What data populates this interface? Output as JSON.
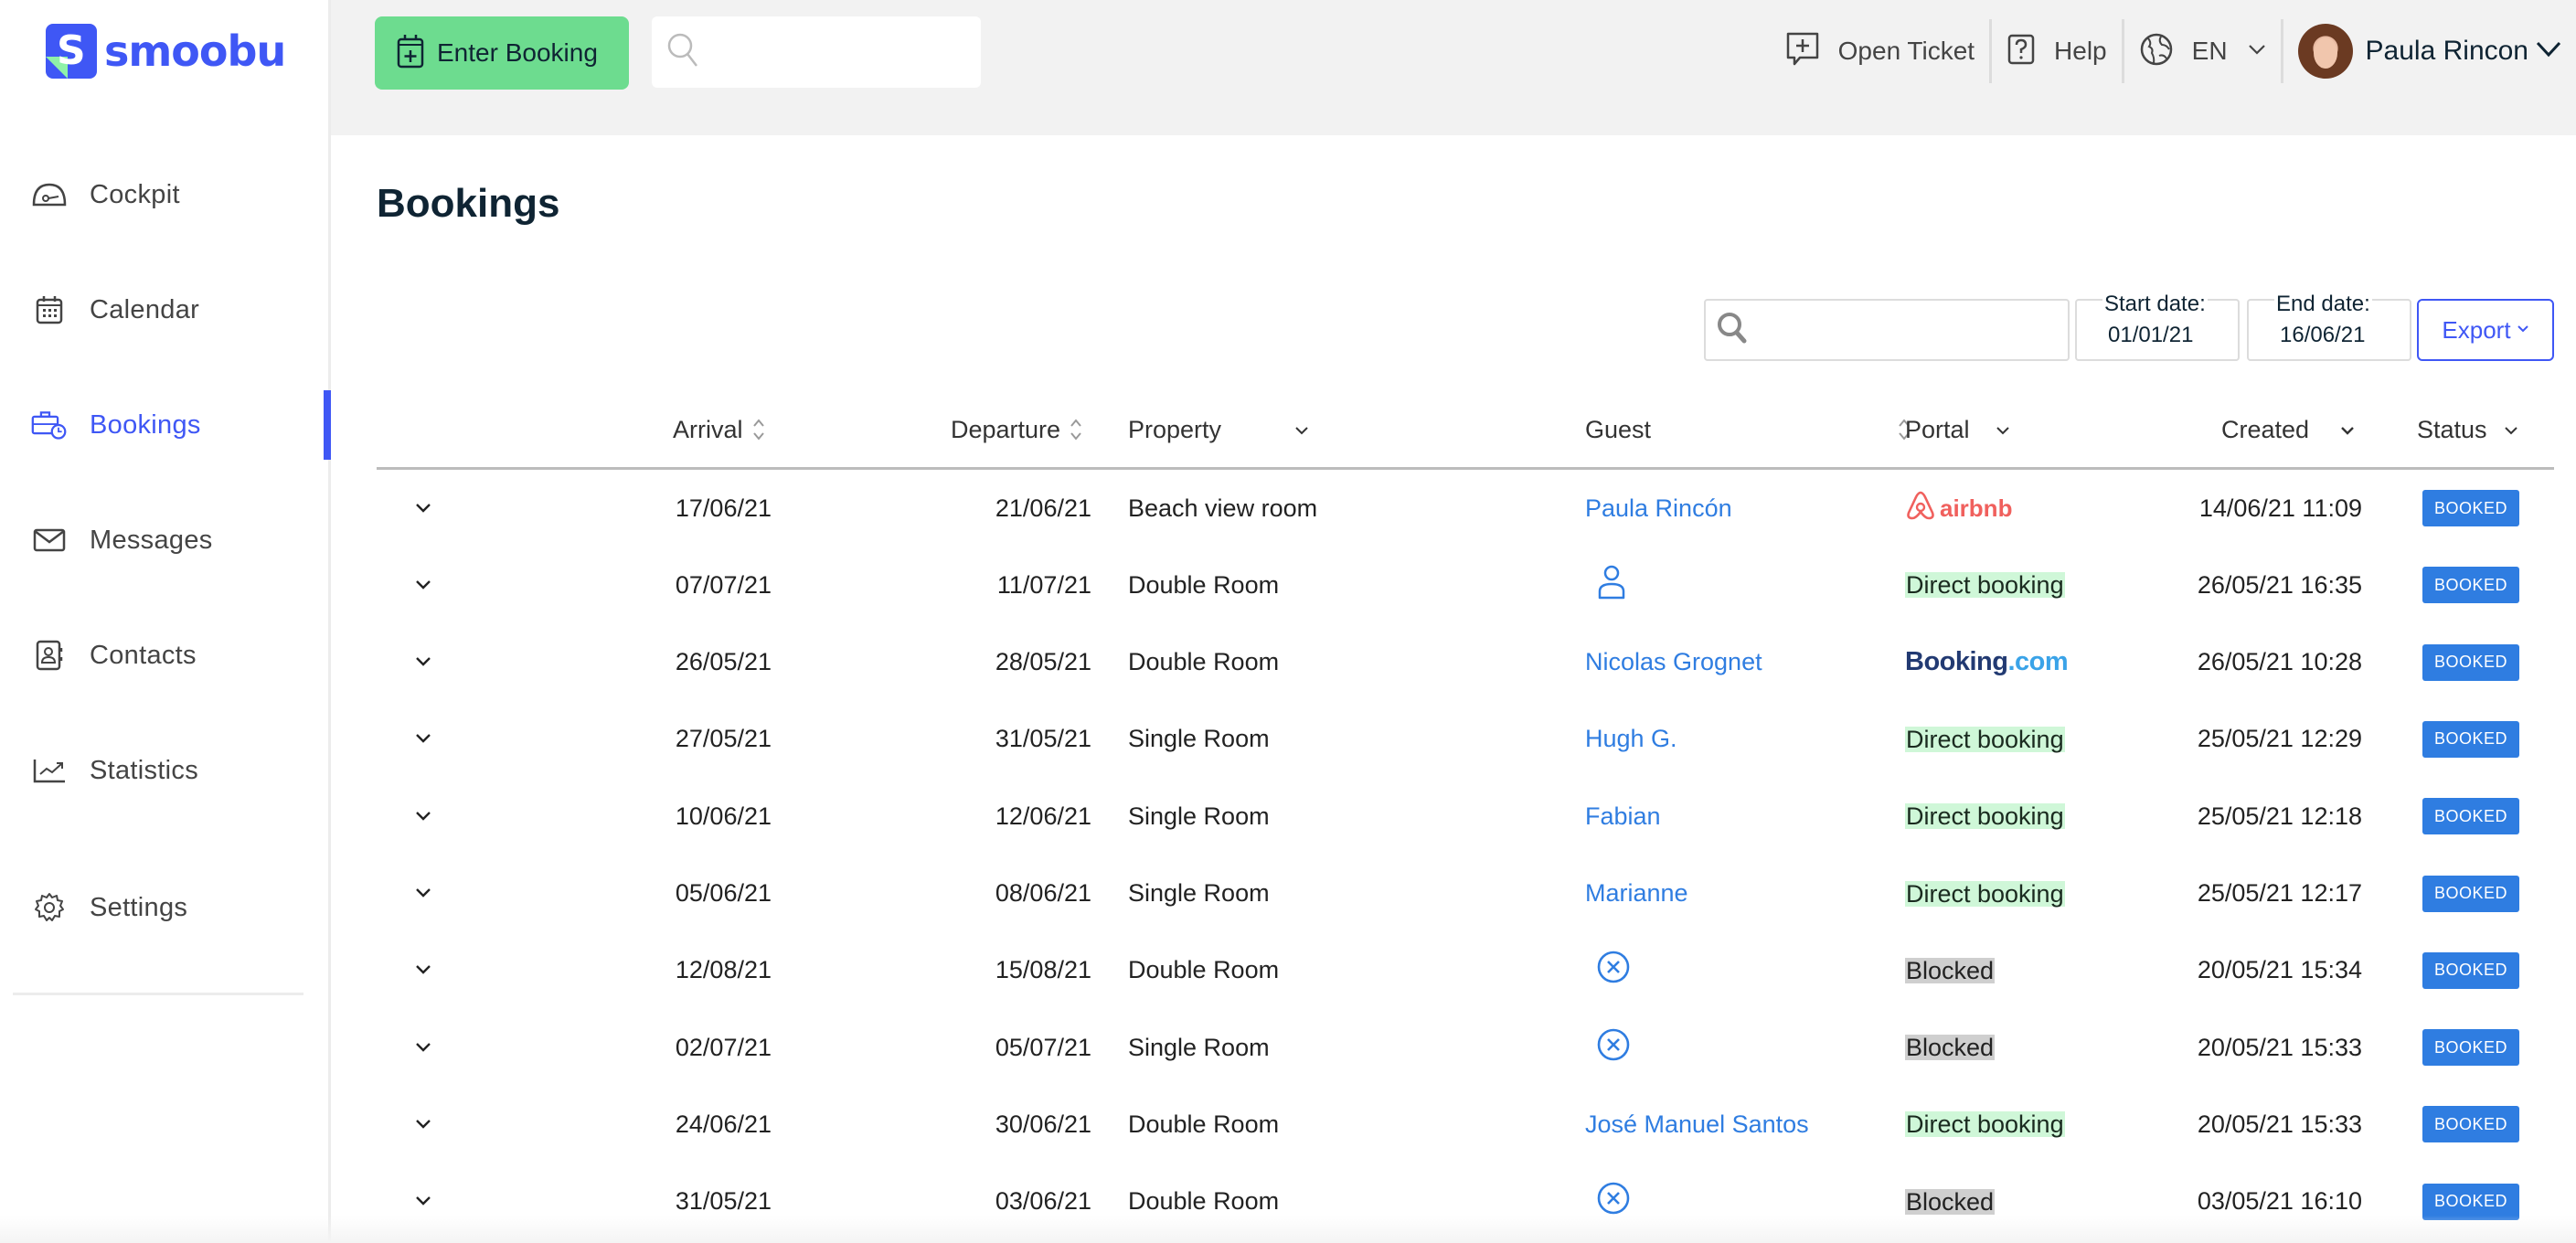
{
  "brand": {
    "name": "smoobu",
    "mark": "S",
    "color": "#3f57f5"
  },
  "sidebar": {
    "items": [
      {
        "label": "Cockpit",
        "icon": "dashboard-gauge-icon",
        "active": false
      },
      {
        "label": "Calendar",
        "icon": "calendar-icon",
        "active": false
      },
      {
        "label": "Bookings",
        "icon": "briefcase-clock-icon",
        "active": true
      },
      {
        "label": "Messages",
        "icon": "envelope-icon",
        "active": false
      },
      {
        "label": "Contacts",
        "icon": "contact-book-icon",
        "active": false
      },
      {
        "label": "Statistics",
        "icon": "trend-chart-icon",
        "active": false
      },
      {
        "label": "Settings",
        "icon": "gear-icon",
        "active": false
      }
    ]
  },
  "topbar": {
    "enter_booking_label": "Enter Booking",
    "search_placeholder": "",
    "open_ticket_label": "Open Ticket",
    "help_label": "Help",
    "language": "EN",
    "user_name": "Paula Rincon"
  },
  "page": {
    "title": "Bookings",
    "filters": {
      "search_placeholder": "",
      "start_date_label": "Start date:",
      "start_date": "01/01/21",
      "end_date_label": "End date:",
      "end_date": "16/06/21",
      "export_label": "Export"
    }
  },
  "table": {
    "columns": {
      "arrival": "Arrival",
      "departure": "Departure",
      "property": "Property",
      "guest": "Guest",
      "portal": "Portal",
      "created": "Created",
      "status": "Status"
    },
    "rows": [
      {
        "arrival": "17/06/21",
        "departure": "21/06/21",
        "property": "Beach view room",
        "guest": "Paula Rincón",
        "guest_type": "name",
        "portal": "airbnb",
        "portal_type": "airbnb",
        "created": "14/06/21 11:09",
        "status": "BOOKED"
      },
      {
        "arrival": "07/07/21",
        "departure": "11/07/21",
        "property": "Double Room",
        "guest": "",
        "guest_type": "person-icon",
        "portal": "Direct booking",
        "portal_type": "direct",
        "created": "26/05/21 16:35",
        "status": "BOOKED"
      },
      {
        "arrival": "26/05/21",
        "departure": "28/05/21",
        "property": "Double Room",
        "guest": "Nicolas Grognet",
        "guest_type": "name",
        "portal": "Booking.com",
        "portal_type": "bookingcom",
        "created": "26/05/21 10:28",
        "status": "BOOKED"
      },
      {
        "arrival": "27/05/21",
        "departure": "31/05/21",
        "property": "Single Room",
        "guest": "Hugh G.",
        "guest_type": "name",
        "portal": "Direct booking",
        "portal_type": "direct",
        "created": "25/05/21 12:29",
        "status": "BOOKED"
      },
      {
        "arrival": "10/06/21",
        "departure": "12/06/21",
        "property": "Single Room",
        "guest": "Fabian",
        "guest_type": "name",
        "portal": "Direct booking",
        "portal_type": "direct",
        "created": "25/05/21 12:18",
        "status": "BOOKED"
      },
      {
        "arrival": "05/06/21",
        "departure": "08/06/21",
        "property": "Single Room",
        "guest": "Marianne",
        "guest_type": "name",
        "portal": "Direct booking",
        "portal_type": "direct",
        "created": "25/05/21 12:17",
        "status": "BOOKED"
      },
      {
        "arrival": "12/08/21",
        "departure": "15/08/21",
        "property": "Double Room",
        "guest": "",
        "guest_type": "blocked-icon",
        "portal": "Blocked",
        "portal_type": "blocked",
        "created": "20/05/21 15:34",
        "status": "BOOKED"
      },
      {
        "arrival": "02/07/21",
        "departure": "05/07/21",
        "property": "Single Room",
        "guest": "",
        "guest_type": "blocked-icon",
        "portal": "Blocked",
        "portal_type": "blocked",
        "created": "20/05/21 15:33",
        "status": "BOOKED"
      },
      {
        "arrival": "24/06/21",
        "departure": "30/06/21",
        "property": "Double Room",
        "guest": "José Manuel Santos",
        "guest_type": "name",
        "portal": "Direct booking",
        "portal_type": "direct",
        "created": "20/05/21 15:33",
        "status": "BOOKED"
      },
      {
        "arrival": "31/05/21",
        "departure": "03/06/21",
        "property": "Double Room",
        "guest": "",
        "guest_type": "blocked-icon",
        "portal": "Blocked",
        "portal_type": "blocked",
        "created": "03/05/21 16:10",
        "status": "BOOKED"
      }
    ]
  },
  "colors": {
    "accent": "#3f57f5",
    "enter_booking_bg": "#6ddc8f",
    "link": "#2f7de1",
    "badge_bg": "#2f7de1",
    "direct_highlight": "#cff7d8",
    "blocked_highlight": "#cfcfcf",
    "airbnb": "#f0605d",
    "bookingcom_dark": "#223a72",
    "bookingcom_light": "#3aa3e8"
  }
}
